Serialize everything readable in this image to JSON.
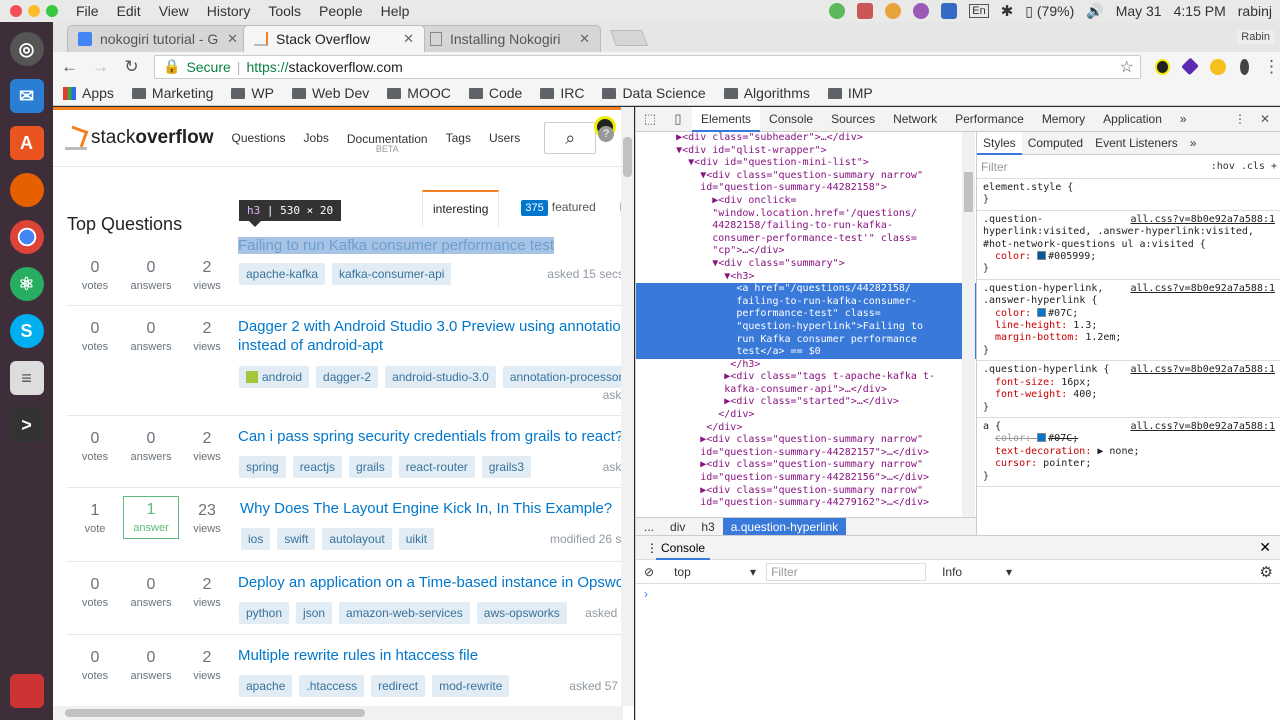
{
  "os": {
    "menus": [
      "File",
      "Edit",
      "View",
      "History",
      "Tools",
      "People",
      "Help"
    ],
    "battery": "(79%)",
    "date": "May 31",
    "time": "4:15 PM",
    "user": "rabinj",
    "lang": "En"
  },
  "browser": {
    "tabs": [
      {
        "title": "nokogiri tutorial - G",
        "active": false
      },
      {
        "title": "Stack Overflow",
        "active": true
      },
      {
        "title": "Installing Nokogiri",
        "active": false
      }
    ],
    "profile": "Rabin",
    "secure_label": "Secure",
    "url_scheme": "https://",
    "url_rest": "stackoverflow.com",
    "bookmarks": [
      "Apps",
      "Marketing",
      "WP",
      "Web Dev",
      "MOOC",
      "Code",
      "IRC",
      "Data Science",
      "Algorithms",
      "IMP"
    ]
  },
  "so": {
    "logo_plain": "stack",
    "logo_bold": "overflow",
    "nav": [
      "Questions",
      "Jobs",
      "Documentation",
      "Tags",
      "Users"
    ],
    "doc_beta": "BETA",
    "top_title": "Top Questions",
    "tab_interesting": "interesting",
    "featured_count": "375",
    "tab_featured": "featured",
    "tab_hot": "hc",
    "tooltip_tag": "h3",
    "tooltip_size": "530 × 20",
    "questions": [
      {
        "votes": "0",
        "votes_l": "votes",
        "answers": "0",
        "answers_l": "answers",
        "views": "2",
        "views_l": "views",
        "title": "Failing to run Kafka consumer performance test",
        "tags": [
          "apache-kafka",
          "kafka-consumer-api"
        ],
        "asked": "asked 15 secs a"
      },
      {
        "votes": "0",
        "votes_l": "votes",
        "answers": "0",
        "answers_l": "answers",
        "views": "2",
        "views_l": "views",
        "title": "Dagger 2 with Android Studio 3.0 Preview using annotatio",
        "title2": "instead of android-apt",
        "tags": [
          "android",
          "dagger-2",
          "android-studio-3.0",
          "annotation-processor",
          "a"
        ],
        "asked": "askec"
      },
      {
        "votes": "0",
        "votes_l": "votes",
        "answers": "0",
        "answers_l": "answers",
        "views": "2",
        "views_l": "views",
        "title": "Can i pass spring security credentials from grails to react?",
        "tags": [
          "spring",
          "reactjs",
          "grails",
          "react-router",
          "grails3"
        ],
        "asked": "askec"
      },
      {
        "votes": "1",
        "votes_l": "vote",
        "answers": "1",
        "answers_l": "answer",
        "views": "23",
        "views_l": "views",
        "title": "Why Does The Layout Engine Kick In, In This Example?",
        "tags": [
          "ios",
          "swift",
          "autolayout",
          "uikit"
        ],
        "asked": "modified 26 sec"
      },
      {
        "votes": "0",
        "votes_l": "votes",
        "answers": "0",
        "answers_l": "answers",
        "views": "2",
        "views_l": "views",
        "title": "Deploy an application on a Time-based instance in Opswo",
        "tags": [
          "python",
          "json",
          "amazon-web-services",
          "aws-opsworks"
        ],
        "asked": "asked 37"
      },
      {
        "votes": "0",
        "votes_l": "votes",
        "answers": "0",
        "answers_l": "answers",
        "views": "2",
        "views_l": "views",
        "title": "Multiple rewrite rules in htaccess file",
        "tags": [
          "apache",
          ".htaccess",
          "redirect",
          "mod-rewrite"
        ],
        "asked": "asked 57 se"
      }
    ]
  },
  "devtools": {
    "tabs": [
      "Elements",
      "Console",
      "Sources",
      "Network",
      "Performance",
      "Memory",
      "Application"
    ],
    "dom_lines": [
      "      ▶<div class=\"subheader\">…</div>",
      "      ▼<div id=\"qlist-wrapper\">",
      "        ▼<div id=\"question-mini-list\">",
      "          ▼<div class=\"question-summary narrow\"",
      "          id=\"question-summary-44282158\">",
      "            ▶<div onclick=",
      "            \"window.location.href='/questions/",
      "            44282158/failing-to-run-kafka-",
      "            consumer-performance-test'\" class=",
      "            \"cp\">…</div>",
      "            ▼<div class=\"summary\">",
      "              ▼<h3>",
      "                <a href=\"/questions/44282158/",
      "                failing-to-run-kafka-consumer-",
      "                performance-test\" class=",
      "                \"question-hyperlink\">Failing to",
      "                run Kafka consumer performance",
      "                test</a> == $0",
      "               </h3>",
      "              ▶<div class=\"tags t-apache-kafka t-",
      "              kafka-consumer-api\">…</div>",
      "              ▶<div class=\"started\">…</div>",
      "             </div>",
      "           </div>",
      "          ▶<div class=\"question-summary narrow\"",
      "          id=\"question-summary-44282157\">…</div>",
      "          ▶<div class=\"question-summary narrow\"",
      "          id=\"question-summary-44282156\">…</div>",
      "          ▶<div class=\"question-summary narrow\"",
      "          id=\"question-summary-44279162\">…</div>"
    ],
    "crumbs": [
      "...",
      "div",
      "h3",
      "a.question-hyperlink"
    ],
    "style_tabs": [
      "Styles",
      "Computed",
      "Event Listeners"
    ],
    "filter_placeholder": "Filter",
    "hov_cls": ":hov  .cls  +",
    "rules": [
      {
        "sel": "element.style {",
        "src": "",
        "props": []
      },
      {
        "sel": ".question-hyperlink:visited, .answer-hyperlink:visited, #hot-network-questions ul a:visited {",
        "src": "all.css?v=8b0e92a7a588:1",
        "props": [
          {
            "n": "color",
            "v": "#005999;",
            "sw": "#005999",
            "strike": false
          }
        ]
      },
      {
        "sel": ".question-hyperlink, .answer-hyperlink {",
        "src": "all.css?v=8b0e92a7a588:1",
        "props": [
          {
            "n": "color",
            "v": "#07C;",
            "sw": "#0077cc",
            "strike": false
          },
          {
            "n": "line-height",
            "v": "1.3;",
            "strike": false
          },
          {
            "n": "margin-bottom",
            "v": "1.2em;",
            "strike": false
          }
        ]
      },
      {
        "sel": ".question-hyperlink {",
        "src": "all.css?v=8b0e92a7a588:1",
        "props": [
          {
            "n": "font-size",
            "v": "16px;",
            "strike": false
          },
          {
            "n": "font-weight",
            "v": "400;",
            "strike": false
          }
        ]
      },
      {
        "sel": "a {",
        "src": "all.css?v=8b0e92a7a588:1",
        "props": [
          {
            "n": "color",
            "v": "#07C;",
            "sw": "#0077cc",
            "strike": true
          },
          {
            "n": "text-decoration",
            "v": "▶ none;",
            "strike": false
          },
          {
            "n": "cursor",
            "v": "pointer;",
            "strike": false
          }
        ]
      }
    ],
    "console_title": "Console",
    "context": "top",
    "console_filter": "Filter",
    "levels": "Info",
    "prompt": "›"
  },
  "colors": {
    "so_orange": "#f48024",
    "link": "#0077cc",
    "devtools_select": "#3879d9"
  }
}
